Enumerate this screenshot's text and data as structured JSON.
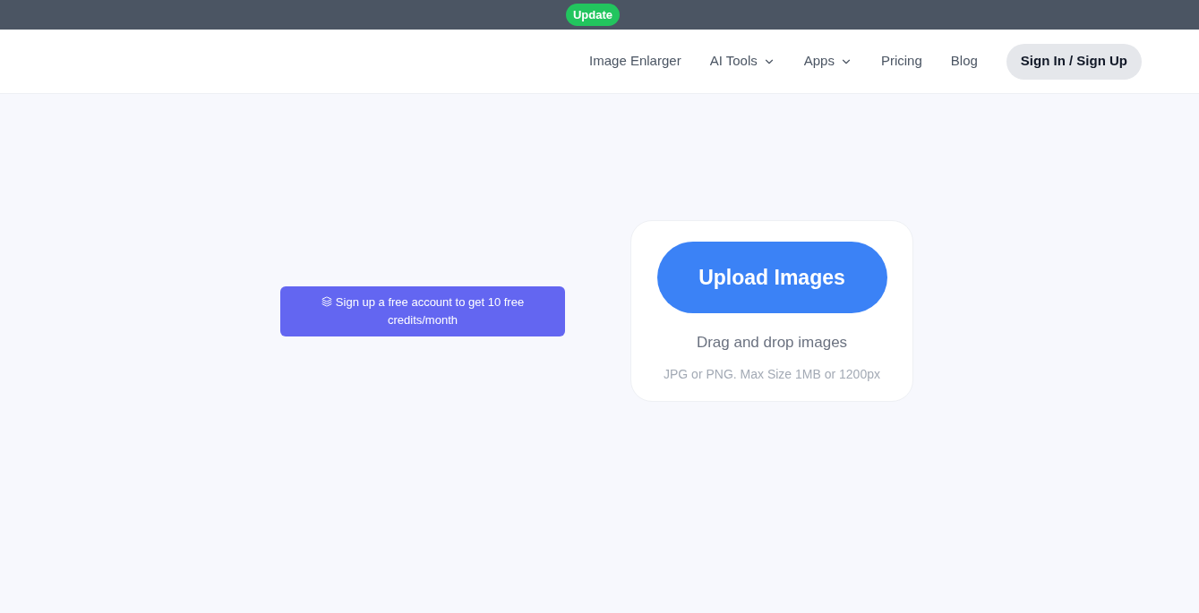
{
  "banner": {
    "badge": "Update"
  },
  "nav": {
    "items": [
      {
        "label": "Image Enlarger",
        "kind": "link"
      },
      {
        "label": "AI Tools",
        "kind": "dropdown"
      },
      {
        "label": "Apps",
        "kind": "dropdown"
      },
      {
        "label": "Pricing",
        "kind": "link"
      },
      {
        "label": "Blog",
        "kind": "link"
      }
    ],
    "sign_in": "Sign In / Sign Up"
  },
  "promo": {
    "text": "Sign up a free account to get 10 free credits/month"
  },
  "upload": {
    "button": "Upload Images",
    "hint": "Drag and drop images",
    "note": "JPG or PNG. Max Size 1MB or 1200px"
  }
}
